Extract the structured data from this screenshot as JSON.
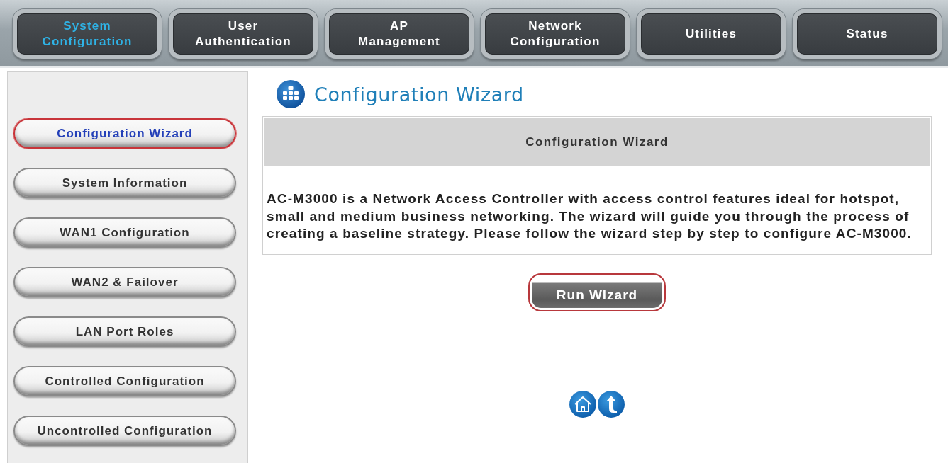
{
  "top_tabs": [
    {
      "label": "System\nConfiguration",
      "selected": true
    },
    {
      "label": "User\nAuthentication",
      "selected": false
    },
    {
      "label": "AP\nManagement",
      "selected": false
    },
    {
      "label": "Network\nConfiguration",
      "selected": false
    },
    {
      "label": "Utilities",
      "selected": false
    },
    {
      "label": "Status",
      "selected": false
    }
  ],
  "sidebar": {
    "items": [
      {
        "label": "Configuration Wizard",
        "selected": true
      },
      {
        "label": "System Information",
        "selected": false
      },
      {
        "label": "WAN1 Configuration",
        "selected": false
      },
      {
        "label": "WAN2 & Failover",
        "selected": false
      },
      {
        "label": "LAN Port Roles",
        "selected": false
      },
      {
        "label": "Controlled Configuration",
        "selected": false
      },
      {
        "label": "Uncontrolled Configuration",
        "selected": false
      }
    ]
  },
  "page_title": "Configuration Wizard",
  "panel": {
    "header": "Configuration Wizard",
    "description": "AC-M3000 is a Network Access Controller with access control features ideal for hotspot, small and medium business networking. The wizard will guide you through the process of creating a baseline strategy. Please follow the wizard step by step to configure AC-M3000."
  },
  "run_button": {
    "label": "Run Wizard"
  }
}
